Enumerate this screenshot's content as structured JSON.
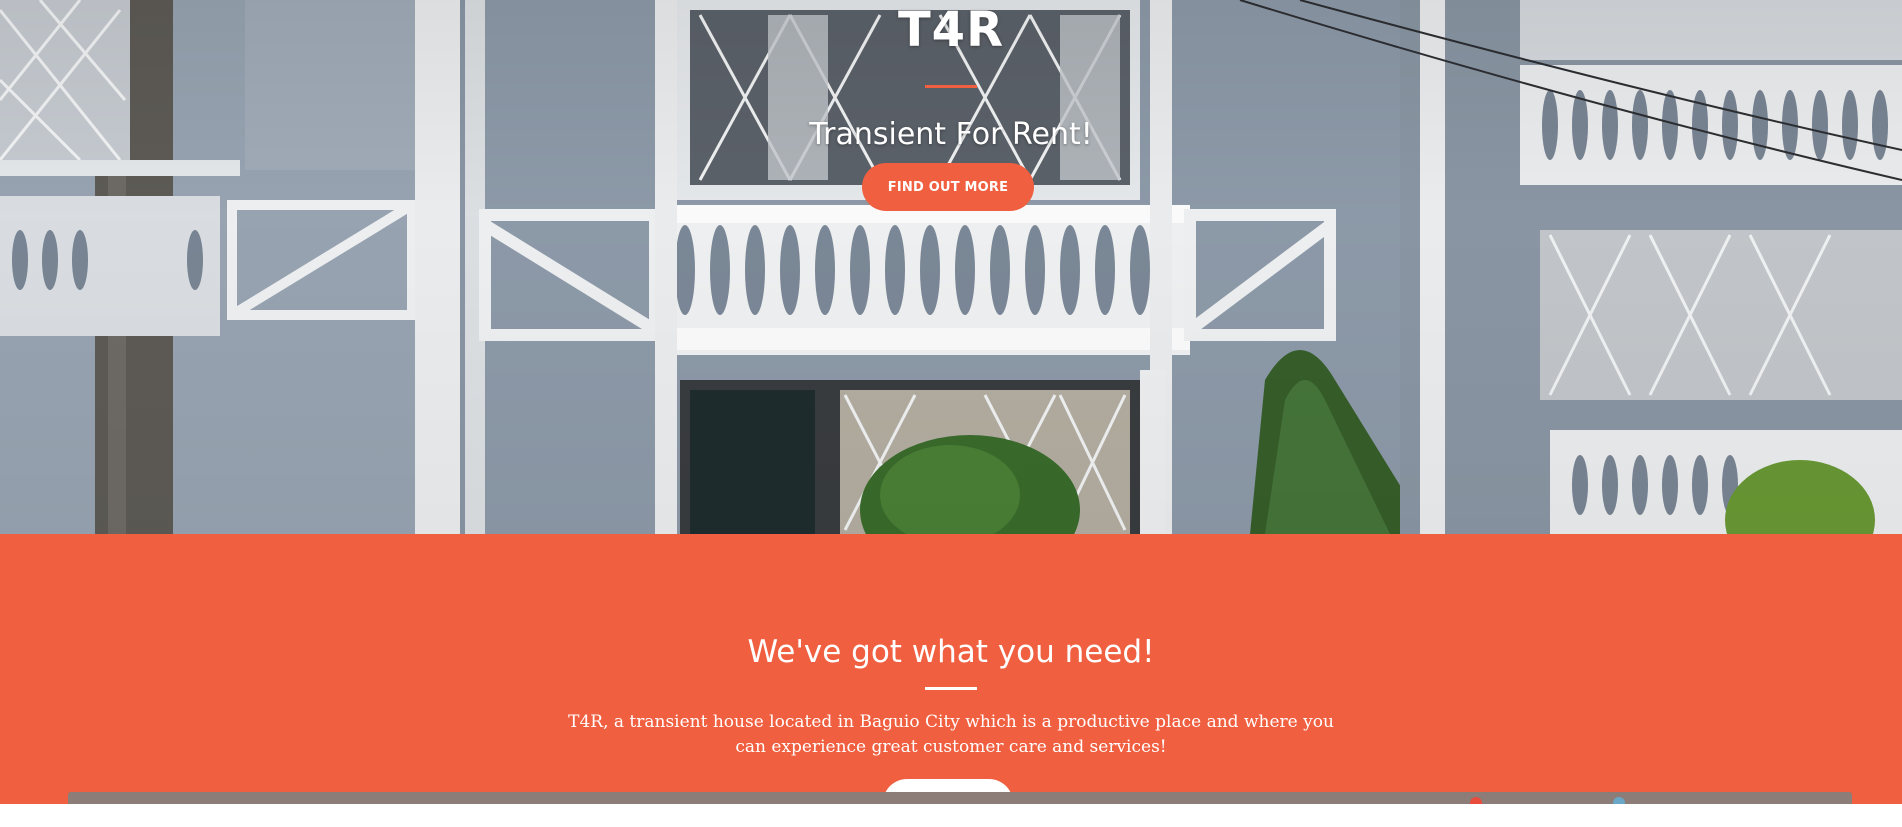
{
  "hero": {
    "title": "T4R",
    "subtitle": "Transient For Rent!",
    "cta_label": "FIND OUT MORE",
    "background_image": "house-facade-photo",
    "accent_color": "#f05f40"
  },
  "about": {
    "heading": "We've got what you need!",
    "body": "T4R, a transient house located in Baguio City which is a productive place and where you can experience great customer care and services!",
    "button_label": "",
    "background_color": "#f05f40"
  }
}
